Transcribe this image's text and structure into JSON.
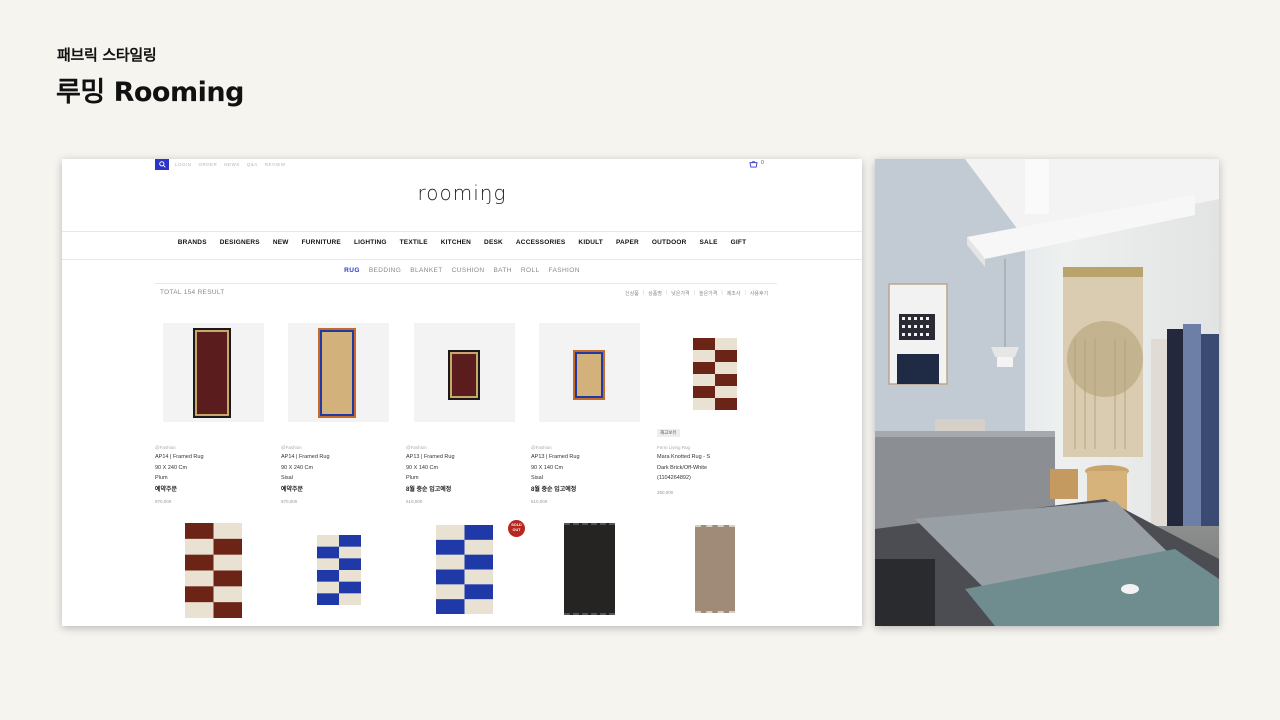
{
  "slide": {
    "subtitle": "패브릭 스타일링",
    "title": "루밍 Rooming"
  },
  "site": {
    "util_links": [
      "LOGIN",
      "ORDER",
      "NEWS",
      "Q&A",
      "REVIEW"
    ],
    "cart_count": "0",
    "logo": "roomiŋg",
    "gnb": [
      "BRANDS",
      "DESIGNERS",
      "NEW",
      "FURNITURE",
      "LIGHTING",
      "TEXTILE",
      "KITCHEN",
      "DESK",
      "ACCESSORIES",
      "KIDULT",
      "PAPER",
      "OUTDOOR",
      "SALE",
      "GIFT"
    ],
    "subnav": [
      "RUG",
      "BEDDING",
      "BLANKET",
      "CUSHION",
      "BATH",
      "ROLL",
      "FASHION"
    ],
    "total": "TOTAL 154 RESULT",
    "sort": [
      "신상품",
      "상품명",
      "낮은가격",
      "높은가격",
      "제조사",
      "사용후기"
    ],
    "products": [
      {
        "brand": "@Fashion",
        "name": "AP14 | Framed Rug",
        "size": "90 X 240 Cm",
        "material": "Plum",
        "status": "예약주문",
        "price": "970,000"
      },
      {
        "brand": "@Fashion",
        "name": "AP14 | Framed Rug",
        "size": "90 X 240 Cm",
        "material": "Sisal",
        "status": "예약주문",
        "price": "970,000"
      },
      {
        "brand": "@Fashion",
        "name": "AP13 | Framed Rug",
        "size": "90 X 140 Cm",
        "material": "Plum",
        "status": "8월 중순 입고예정",
        "price": "610,000"
      },
      {
        "brand": "@Fashion",
        "name": "AP13 | Framed Rug",
        "size": "90 X 140 Cm",
        "material": "Sisal",
        "status": "8월 중순 입고예정",
        "price": "610,000"
      },
      {
        "badge": "재고보유",
        "brand": "Ferm Living Rug",
        "name": "Mara Knotted Rug - S",
        "size": "Dark Brick/Off-White",
        "material": "(1104264892)",
        "price": "350,000"
      }
    ],
    "soldout_label": "SOLD OUT"
  },
  "colors": {
    "accent": "#2d35c9",
    "plum": "#5a1c1c",
    "sisal": "#d2b27a",
    "brick": "#6b2416",
    "offwhite": "#e9e2d3",
    "cobalt": "#1f3aa8",
    "soldout": "#b5271f"
  },
  "icons": [
    "search-icon",
    "cart-icon"
  ]
}
